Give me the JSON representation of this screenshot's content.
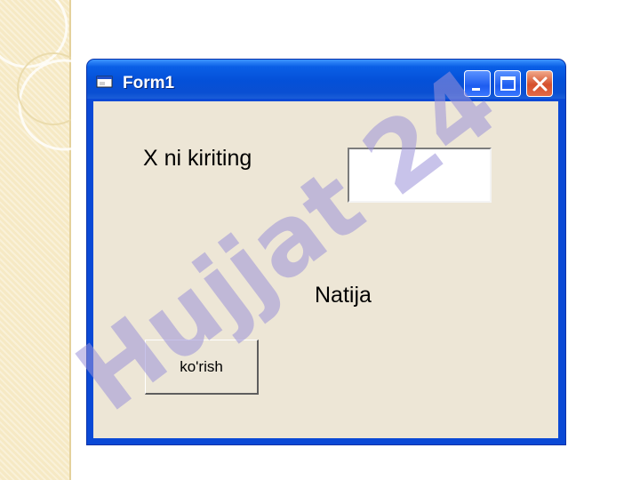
{
  "window": {
    "title": "Form1",
    "icon": "form-icon",
    "controls": [
      "minimize-icon",
      "maximize-icon",
      "close-icon"
    ]
  },
  "form": {
    "input_label": "X ni kiriting",
    "input_value": "",
    "result_label": "Natija",
    "button_label": "ko'rish"
  },
  "watermark": {
    "text": "Hujjat 24"
  },
  "colors": {
    "titlebar": "#0a5fe6",
    "client_bg": "#ede6d6",
    "close_button": "#d5502c",
    "watermark": "#9a92d8"
  }
}
